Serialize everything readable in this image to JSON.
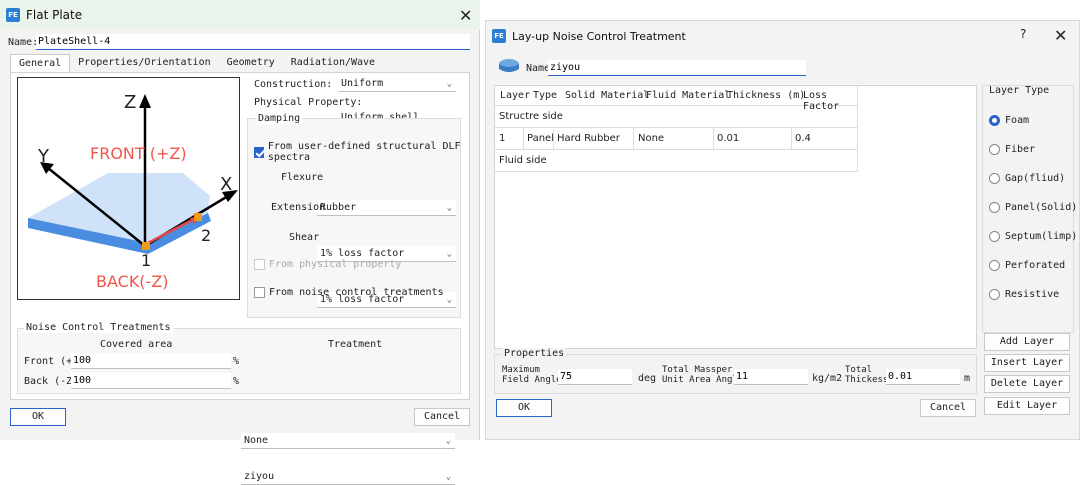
{
  "left_window": {
    "title": "Flat Plate",
    "name_label": "Name:",
    "name_value": "PlateShell-4",
    "tabs": [
      "General",
      "Properties/Orientation",
      "Geometry",
      "Radiation/Wave"
    ],
    "diagram": {
      "axis_z": "Z",
      "axis_y": "Y",
      "axis_x": "X",
      "front_label": "FRONT (+Z)",
      "back_label": "BACK(-Z)",
      "point_1": "1",
      "point_2": "2"
    },
    "construction_label": "Construction:",
    "construction_value": "Uniform",
    "physical_property_label": "Physical Property:",
    "physical_property_value": "Uniform shell",
    "damping_title": "Damping",
    "dlf_checkbox_label": "From user-defined structural DLF spectra",
    "flexure_label": "Flexure",
    "flexure_value": "Rubber",
    "extension_label": "Extension",
    "extension_value": "1% loss factor",
    "shear_label": "Shear",
    "shear_value": "1% loss factor",
    "from_physical_label": "From physical property",
    "from_noise_label": "From noise control treatments",
    "nct_title": "Noise Control Treatments",
    "nct_covered_header": "Covered area",
    "nct_treatment_header": "Treatment",
    "nct_front_label": "Front (+Z)",
    "nct_front_value": "100",
    "nct_front_treatment": "None",
    "nct_back_label": "Back (-Z)",
    "nct_back_value": "100",
    "nct_back_treatment": "ziyou",
    "percent": "%",
    "ok_label": "OK",
    "cancel_label": "Cancel",
    "colors": {
      "accent": "#2a64c9",
      "front_text": "#f0564a",
      "plate_top": "#c8defa",
      "plate_side": "#4a8de0"
    }
  },
  "right_window": {
    "title": "Lay-up Noise Control Treatment",
    "name_label": "Name",
    "name_value": "ziyou",
    "table_headers": [
      "Layer",
      "Type",
      "Solid Material",
      "Fluid Material",
      "Thickness (m)",
      "Loss Factor"
    ],
    "structure_side": "Structre side",
    "rows": [
      {
        "layer": "1",
        "type": "Panel",
        "solid": "Hard Rubber",
        "fluid": "None",
        "thickness": "0.01",
        "loss": "0.4"
      }
    ],
    "fluid_side": "Fluid side",
    "layer_type_title": "Layer Type",
    "layer_types": [
      "Foam",
      "Fiber",
      "Gap(fliud)",
      "Panel(Solid)",
      "Septum(limp)",
      "Perforated",
      "Resistive"
    ],
    "selected_layer_type": "Foam",
    "buttons": [
      "Add Layer",
      "Insert Layer",
      "Delete Layer",
      "Edit Layer"
    ],
    "properties_title": "Properties",
    "max_angle_label": "Maximum\nField Angle",
    "max_angle_value": "75",
    "deg_unit": "deg",
    "total_mass_label": "Total Massper\nUnit Area Angle",
    "total_mass_value": "11",
    "mass_unit": "kg/m2",
    "total_thick_label": "Total\nThickess",
    "total_thick_value": "0.01",
    "thick_unit": "m",
    "ok_label": "OK",
    "cancel_label": "Cancel"
  }
}
